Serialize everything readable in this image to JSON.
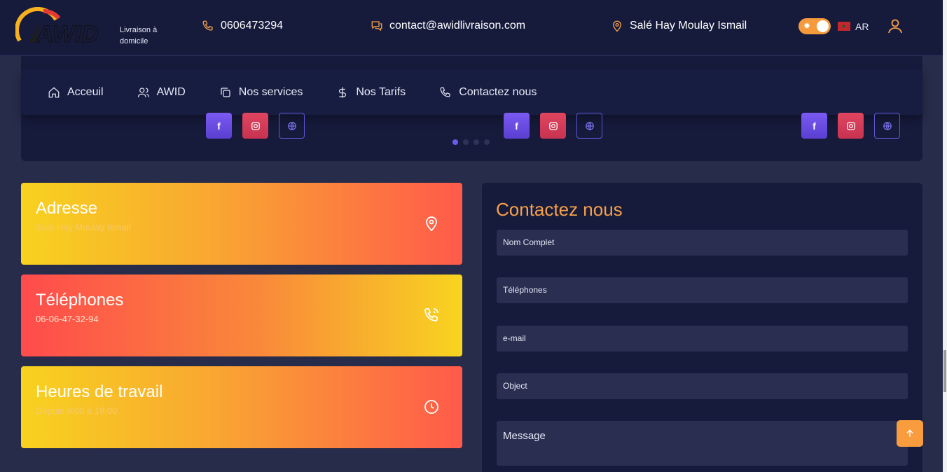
{
  "brand": {
    "logo_text": "AWID",
    "subtitle_line1": "Livraison à",
    "subtitle_line2": "domicile"
  },
  "header": {
    "phone": "0606473294",
    "email": "contact@awidlivraison.com",
    "address": "Salé Hay Moulay Ismail",
    "language": "AR"
  },
  "nav": [
    {
      "label": "Acceuil",
      "icon": "home-icon"
    },
    {
      "label": "AWID",
      "icon": "users-icon"
    },
    {
      "label": "Nos services",
      "icon": "copy-icon"
    },
    {
      "label": "Nos Tarifs",
      "icon": "dollar-icon"
    },
    {
      "label": "Contactez nous",
      "icon": "phone-icon"
    }
  ],
  "cards": [
    {
      "title": "Adresse",
      "value": "Salé Hay Moulay Ismail",
      "icon": "location-pin-icon"
    },
    {
      "title": "Téléphones",
      "value": "06-06-47-32-94",
      "icon": "phone-ringing-icon"
    },
    {
      "title": "Heures de travail",
      "value": "Depuis 9:00 à 19:00",
      "icon": "clock-icon"
    }
  ],
  "contact_form": {
    "title": "Contactez nous",
    "placeholders": [
      "Nom Complet",
      "Téléphones",
      "e-mail",
      "Object",
      "Message"
    ]
  },
  "social_icons": [
    "facebook-icon",
    "instagram-icon",
    "globe-icon"
  ],
  "carousel": {
    "dots": 4,
    "active": 0
  },
  "colors": {
    "accent": "#f6a049",
    "navy": "#161b3c",
    "page_bg": "#272c4b"
  }
}
